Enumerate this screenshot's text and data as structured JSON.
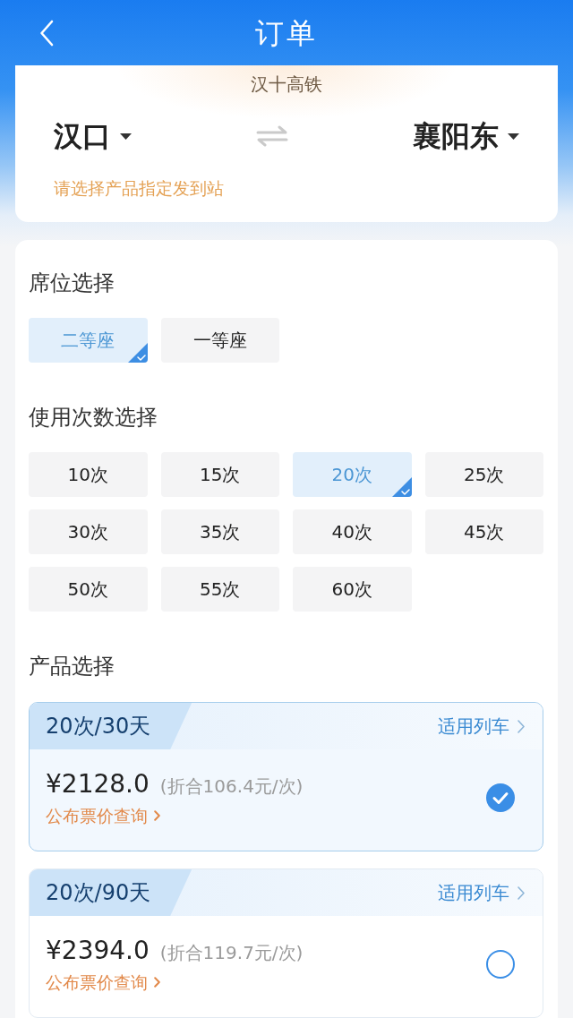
{
  "header": {
    "title": "订单"
  },
  "route": {
    "line_name": "汉十高铁",
    "from": "汉口",
    "to": "襄阳东",
    "hint": "请选择产品指定发到站"
  },
  "seat_section": {
    "title": "席位选择",
    "options": [
      {
        "label": "二等座",
        "selected": true
      },
      {
        "label": "一等座",
        "selected": false
      }
    ]
  },
  "count_section": {
    "title": "使用次数选择",
    "options": [
      {
        "label": "10次",
        "selected": false
      },
      {
        "label": "15次",
        "selected": false
      },
      {
        "label": "20次",
        "selected": true
      },
      {
        "label": "25次",
        "selected": false
      },
      {
        "label": "30次",
        "selected": false
      },
      {
        "label": "35次",
        "selected": false
      },
      {
        "label": "40次",
        "selected": false
      },
      {
        "label": "45次",
        "selected": false
      },
      {
        "label": "50次",
        "selected": false
      },
      {
        "label": "55次",
        "selected": false
      },
      {
        "label": "60次",
        "selected": false
      }
    ]
  },
  "product_section": {
    "title": "产品选择",
    "products": [
      {
        "name": "20次/30天",
        "trains_link": "适用列车",
        "price": "¥2128.0",
        "unit_price": "(折合106.4元/次)",
        "fare_link": "公布票价查询",
        "selected": true
      },
      {
        "name": "20次/90天",
        "trains_link": "适用列车",
        "price": "¥2394.0",
        "unit_price": "(折合119.7元/次)",
        "fare_link": "公布票价查询",
        "selected": false
      }
    ]
  }
}
